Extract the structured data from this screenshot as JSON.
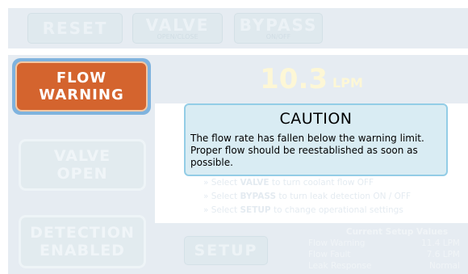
{
  "toolbar": {
    "reset_label": "RESET",
    "valve_label": "VALVE",
    "valve_sub": "OPEN/CLOSE",
    "bypass_label": "BYPASS",
    "bypass_sub": "ON/OFF"
  },
  "status": {
    "flow_warning_line1": "FLOW",
    "flow_warning_line2": "WARNING",
    "valve_line1": "VALVE",
    "valve_line2": "OPEN",
    "detection_line1": "DETECTION",
    "detection_line2": "ENABLED"
  },
  "readout": {
    "value": "10.3",
    "unit": "LPM"
  },
  "hints": {
    "line1_pre": "» Select ",
    "line1_key": "VALVE",
    "line1_post": " to turn coolant flow OFF",
    "line2_pre": "» Select ",
    "line2_key": "BYPASS",
    "line2_post": " to turn leak detection ON / OFF",
    "line3_pre": "» Select ",
    "line3_key": "SETUP",
    "line3_post": " to change operational settings"
  },
  "setup": {
    "button_label": "SETUP",
    "values_title": "Current Setup Values",
    "rows": [
      {
        "label": "Flow Warning",
        "value": "11.4 LPM"
      },
      {
        "label": "Flow Fault",
        "value": "7.6 LPM"
      },
      {
        "label": "Leak Response",
        "value": "Normal"
      }
    ]
  },
  "dialog": {
    "title": "CAUTION",
    "message": "The flow rate has fallen below the warning limit. Proper flow should be reestablished as soon as possible."
  },
  "colors": {
    "warning": "#d4642e",
    "warning_glow": "#7fb3de",
    "dialog_bg": "#d9ecf3",
    "dialog_border": "#93cde6"
  }
}
